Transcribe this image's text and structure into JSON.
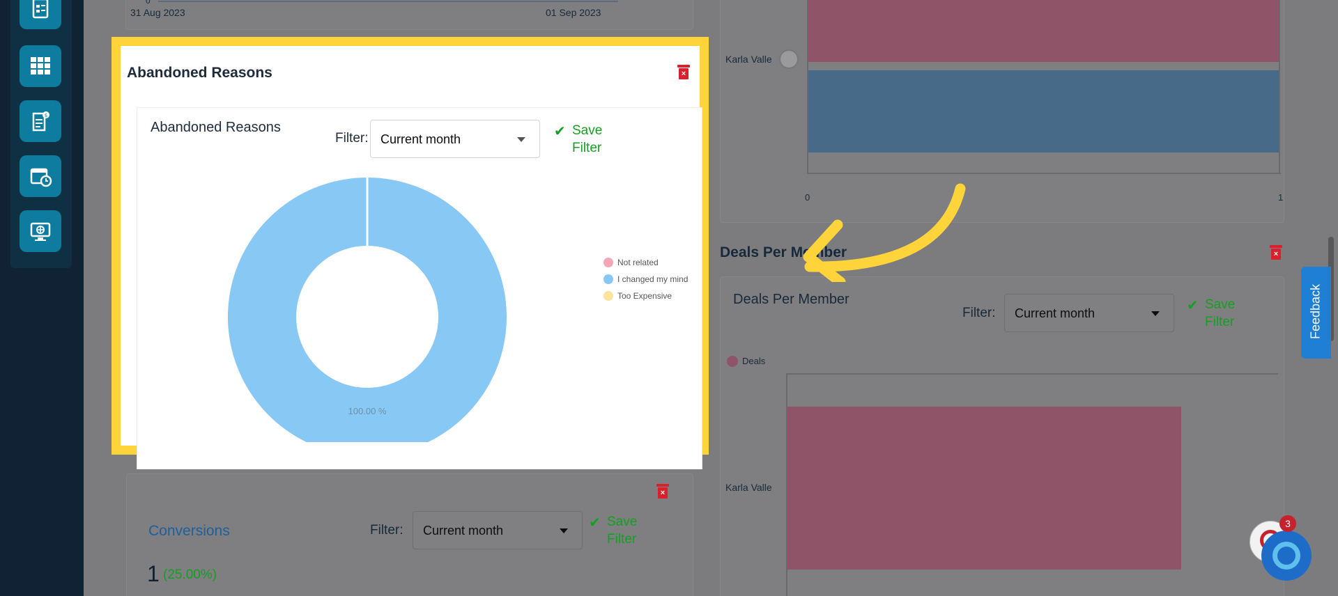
{
  "colors": {
    "highlight": "#ffd43b",
    "slice_changed_mind": "#88c8f4",
    "slice_not_related": "#f7a6b8",
    "slice_too_expensive": "#fde49c",
    "accent_green": "#14a01e",
    "delete_red": "#d9202c"
  },
  "sidebar": {
    "icons": [
      "report-icon",
      "grid-icon",
      "invoice-icon",
      "calendar-clock-icon",
      "web-monitor-icon"
    ]
  },
  "top_left_chart": {
    "x_ticks": [
      "31 Aug 2023",
      "01 Sep 2023"
    ],
    "y_tick_zero": "0"
  },
  "abandoned_reasons_widget": {
    "title": "Abandoned Reasons",
    "chart_title": "Abandoned Reasons",
    "filter_label": "Filter:",
    "filter_value": "Current month",
    "save_filter": [
      "Save",
      "Filter"
    ]
  },
  "chart_data": {
    "type": "pie",
    "donut": true,
    "labels": [
      "Not related",
      "I changed my mind",
      "Too Expensive"
    ],
    "values": [
      0,
      100,
      0
    ],
    "data_label": "100.00 %",
    "legend_placement": "right"
  },
  "conversions_widget": {
    "title": "Conversions",
    "filter_label": "Filter:",
    "filter_value": "Current month",
    "save_filter": [
      "Save",
      "Filter"
    ],
    "count": "1",
    "percent": "(25.00%)"
  },
  "top_right_chart": {
    "member": "Karla Valle",
    "x_ticks": [
      "0",
      "1"
    ]
  },
  "deals_per_member_widget": {
    "title": "Deals Per Member",
    "chart_title": "Deals Per Member",
    "filter_label": "Filter:",
    "filter_value": "Current month",
    "save_filter": [
      "Save",
      "Filter"
    ],
    "legend": "Deals",
    "member": "Karla Valle"
  },
  "feedback": {
    "label": "Feedback"
  },
  "chat": {
    "badge": "3"
  }
}
